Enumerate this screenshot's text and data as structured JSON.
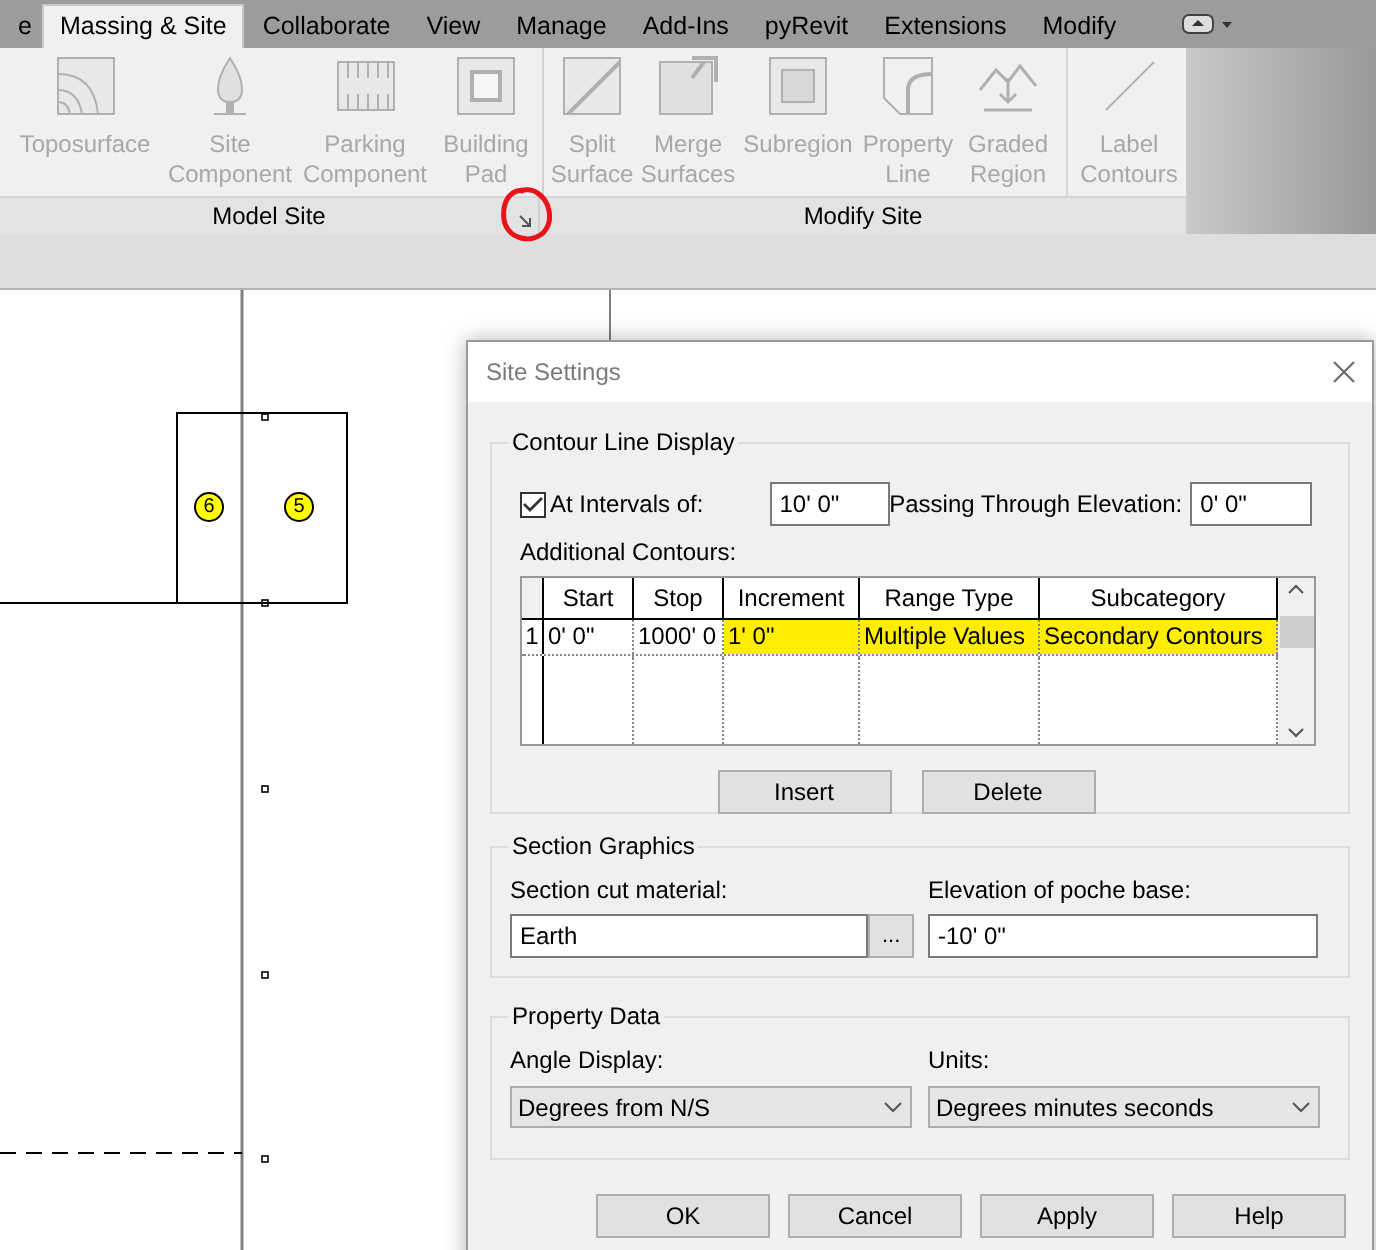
{
  "ribbon_tabs": [
    {
      "label": "e",
      "selected": false
    },
    {
      "label": "Massing & Site",
      "selected": true
    },
    {
      "label": "Collaborate",
      "selected": false
    },
    {
      "label": "View",
      "selected": false
    },
    {
      "label": "Manage",
      "selected": false
    },
    {
      "label": "Add-Ins",
      "selected": false
    },
    {
      "label": "pyRevit",
      "selected": false
    },
    {
      "label": "Extensions",
      "selected": false
    },
    {
      "label": "Modify",
      "selected": false
    }
  ],
  "panels": [
    {
      "label": "Model Site",
      "launcher": true,
      "buttons": [
        {
          "label": "Toposurface",
          "disabled": true
        },
        {
          "label": "Site Component",
          "disabled": true
        },
        {
          "label": "Parking Component",
          "disabled": true
        },
        {
          "label": "Building Pad",
          "disabled": true
        }
      ]
    },
    {
      "label": "Modify Site",
      "launcher": false,
      "buttons": [
        {
          "label": "Split Surface",
          "disabled": true
        },
        {
          "label": "Merge Surfaces",
          "disabled": true
        },
        {
          "label": "Subregion",
          "disabled": true
        },
        {
          "label": "Property Line",
          "disabled": true
        },
        {
          "label": "Graded Region",
          "disabled": true
        },
        {
          "label": "Label Contours",
          "disabled": true
        }
      ]
    }
  ],
  "canvas": {
    "markers": [
      "6",
      "5"
    ]
  },
  "dialog": {
    "title": "Site Settings",
    "contour_group": {
      "title": "Contour Line Display",
      "at_intervals": {
        "label": "At Intervals of:",
        "checked": true,
        "value": "10'  0\""
      },
      "passing_through": {
        "label": "Passing Through Elevation:",
        "value": "0'  0\""
      },
      "additional_label": "Additional Contours:",
      "table": {
        "columns": [
          "Start",
          "Stop",
          "Increment",
          "Range Type",
          "Subcategory"
        ],
        "rows": [
          {
            "number": "1",
            "cells": [
              "0'  0\"",
              "1000'  0",
              "1'  0\"",
              "Multiple Values",
              "Secondary Contours"
            ],
            "highlighted": true
          }
        ]
      },
      "buttons": [
        "Insert",
        "Delete"
      ]
    },
    "section_group": {
      "title": "Section Graphics",
      "material_label": "Section cut material:",
      "material": "Earth",
      "browse": "...",
      "poche_label": "Elevation of poche base:",
      "poche": "-10'  0\""
    },
    "property_group": {
      "title": "Property Data",
      "angle_label": "Angle Display:",
      "angle": "Degrees from N/S",
      "units_label": "Units:",
      "units": "Degrees minutes seconds"
    },
    "buttons": [
      "OK",
      "Cancel",
      "Apply",
      "Help"
    ]
  }
}
